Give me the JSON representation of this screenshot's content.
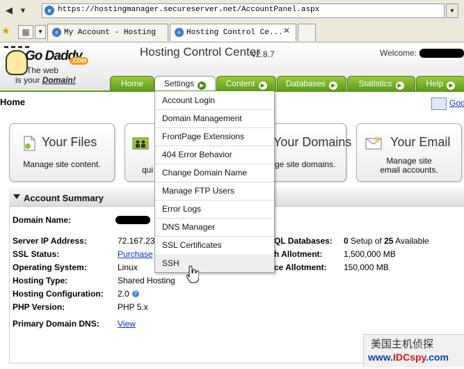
{
  "browser": {
    "url": "https://hostingmanager.secureserver.net/AccountPanel.aspx",
    "tabs": [
      {
        "label": "My Account - Hosting"
      },
      {
        "label": "Hosting Control Ce..."
      }
    ]
  },
  "header": {
    "logo": {
      "word": "Go Daddy",
      "com": ".COM",
      "tagline_1": "The web",
      "tagline_2": "is your",
      "tagline_3": "Domain!"
    },
    "title": "Hosting Control Center",
    "version": "v2.8.7",
    "welcome": "Welcome:"
  },
  "nav": {
    "tabs": [
      {
        "label": "Home"
      },
      {
        "label": "Settings"
      },
      {
        "label": "Content"
      },
      {
        "label": "Databases"
      },
      {
        "label": "Statistics"
      },
      {
        "label": "Help"
      }
    ]
  },
  "page": {
    "title": "Home",
    "godaddy_link": "God"
  },
  "cards": [
    {
      "title": "Your Files",
      "desc": "Manage site content."
    },
    {
      "title": "",
      "desc": "qui"
    },
    {
      "title": "Your Domains",
      "desc": "ge site domains."
    },
    {
      "title": "Your Email",
      "desc_1": "Manage site",
      "desc_2": "email accounts."
    }
  ],
  "summary": {
    "title": "Account Summary",
    "domain_name_label": "Domain Name:",
    "server_ip_label": "Server IP Address:",
    "server_ip_value": "72.167.23",
    "ssl_label": "SSL Status:",
    "ssl_value": "Purchase",
    "os_label": "Operating System:",
    "os_value": "Linux",
    "hosting_type_label": "Hosting Type:",
    "hosting_type_value": "Shared Hosting",
    "hosting_config_label": "Hosting Configuration:",
    "hosting_config_value": "2.0",
    "php_label": "PHP Version:",
    "php_value": "PHP 5.x",
    "dns_label": "Primary Domain DNS:",
    "dns_value": "View",
    "db_label": "QL Databases:",
    "db_value_prefix": "0",
    "db_value_mid": "Setup of",
    "db_value_num": "25",
    "db_value_suffix": "Available",
    "bw_label": "h Allotment:",
    "bw_value": "1,500,000 MB",
    "space_label": "ce Allotment:",
    "space_value": "150,000 MB"
  },
  "settings_menu": {
    "items": [
      {
        "label": "Account Login"
      },
      {
        "label": "Domain Management"
      },
      {
        "label": "FrontPage Extensions"
      },
      {
        "label": "404 Error Behavior"
      },
      {
        "label": "Change Domain Name"
      },
      {
        "label": "Manage FTP Users"
      },
      {
        "label": "Error Logs"
      },
      {
        "label": "DNS Manager"
      },
      {
        "label": "SSL Certificates"
      },
      {
        "label": "SSH"
      }
    ]
  },
  "watermark": {
    "cn": "美国主机侦探",
    "url_1": "www.",
    "url_2": "IDCspy",
    "url_3": ".com"
  }
}
